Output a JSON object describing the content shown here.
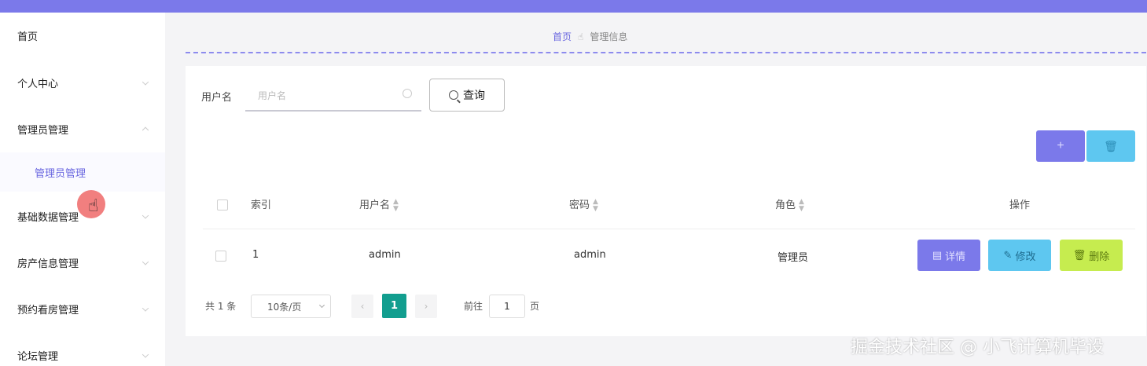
{
  "topbar": {
    "title": ""
  },
  "sidebar": {
    "items": [
      {
        "label": "首页"
      },
      {
        "label": "个人中心"
      },
      {
        "label": "管理员管理"
      },
      {
        "label": "管理员管理"
      },
      {
        "label": "基础数据管理"
      },
      {
        "label": "房产信息管理"
      },
      {
        "label": "预约看房管理"
      },
      {
        "label": "论坛管理"
      }
    ]
  },
  "breadcrumb": {
    "home": "首页",
    "current": "管理信息"
  },
  "search": {
    "label": "用户名",
    "placeholder": "用户名",
    "button": "查询"
  },
  "toolbar": {
    "add": "+",
    "delete": "🗑"
  },
  "table": {
    "columns": [
      "索引",
      "用户名",
      "密码",
      "角色",
      "操作"
    ],
    "rows": [
      {
        "index": "1",
        "username": "admin",
        "password": "admin",
        "role": "管理员"
      }
    ],
    "actions": {
      "detail": "详情",
      "edit": "修改",
      "delete": "删除"
    }
  },
  "pagination": {
    "total": "共 1 条",
    "page_size": "10条/页",
    "current": "1",
    "goto_label": "前往",
    "goto_value": "1",
    "page_suffix": "页"
  },
  "watermark": "掘金技术社区 @ 小飞计算机毕设",
  "colors": {
    "accent": "#7b79ea",
    "info": "#5ec7f0",
    "warning": "#c6ec4f",
    "active_page": "#129e8f"
  }
}
